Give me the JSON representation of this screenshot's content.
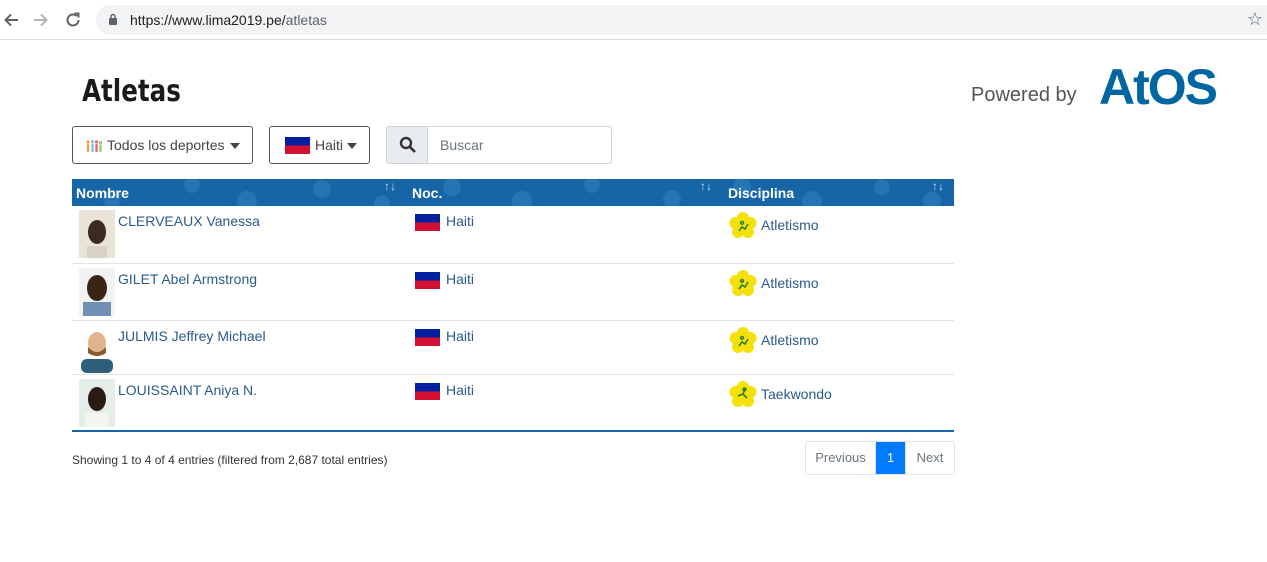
{
  "browser": {
    "url_host": "https://www.lima2019.pe/",
    "url_path": "atletas"
  },
  "page": {
    "title": "Atletas",
    "powered_by": "Powered by",
    "brand": "Atos"
  },
  "filters": {
    "sport_label": "Todos los deportes",
    "country_label": "Haiti",
    "search_placeholder": "Buscar"
  },
  "table": {
    "headers": [
      "Nombre",
      "Noc.",
      "Disciplina"
    ],
    "rows": [
      {
        "name": "CLERVEAUX Vanessa",
        "noc": "Haiti",
        "discipline": "Atletismo"
      },
      {
        "name": "GILET Abel Armstrong",
        "noc": "Haiti",
        "discipline": "Atletismo"
      },
      {
        "name": "JULMIS Jeffrey Michael",
        "noc": "Haiti",
        "discipline": "Atletismo"
      },
      {
        "name": "LOUISSAINT Aniya N.",
        "noc": "Haiti",
        "discipline": "Taekwondo"
      }
    ]
  },
  "footer": {
    "info": "Showing 1 to 4 of 4 entries (filtered from 2,687 total entries)",
    "prev": "Previous",
    "current": "1",
    "next": "Next"
  },
  "icons": {
    "back": "arrow-left-icon",
    "forward": "arrow-right-icon",
    "reload": "reload-icon",
    "lock": "lock-icon",
    "bookmark": "star-icon",
    "search": "search-icon",
    "sport": "sports-people-icon",
    "flag": "haiti-flag-icon",
    "discipline": "discipline-flower-icon"
  },
  "colors": {
    "header_blue": "#1565a7",
    "link": "#2b5a8c",
    "pager_active": "#007bff",
    "brand_blue": "#0066a1",
    "haiti_blue": "#00209f",
    "haiti_red": "#d21034",
    "discipline_yellow": "#f5e10a"
  }
}
